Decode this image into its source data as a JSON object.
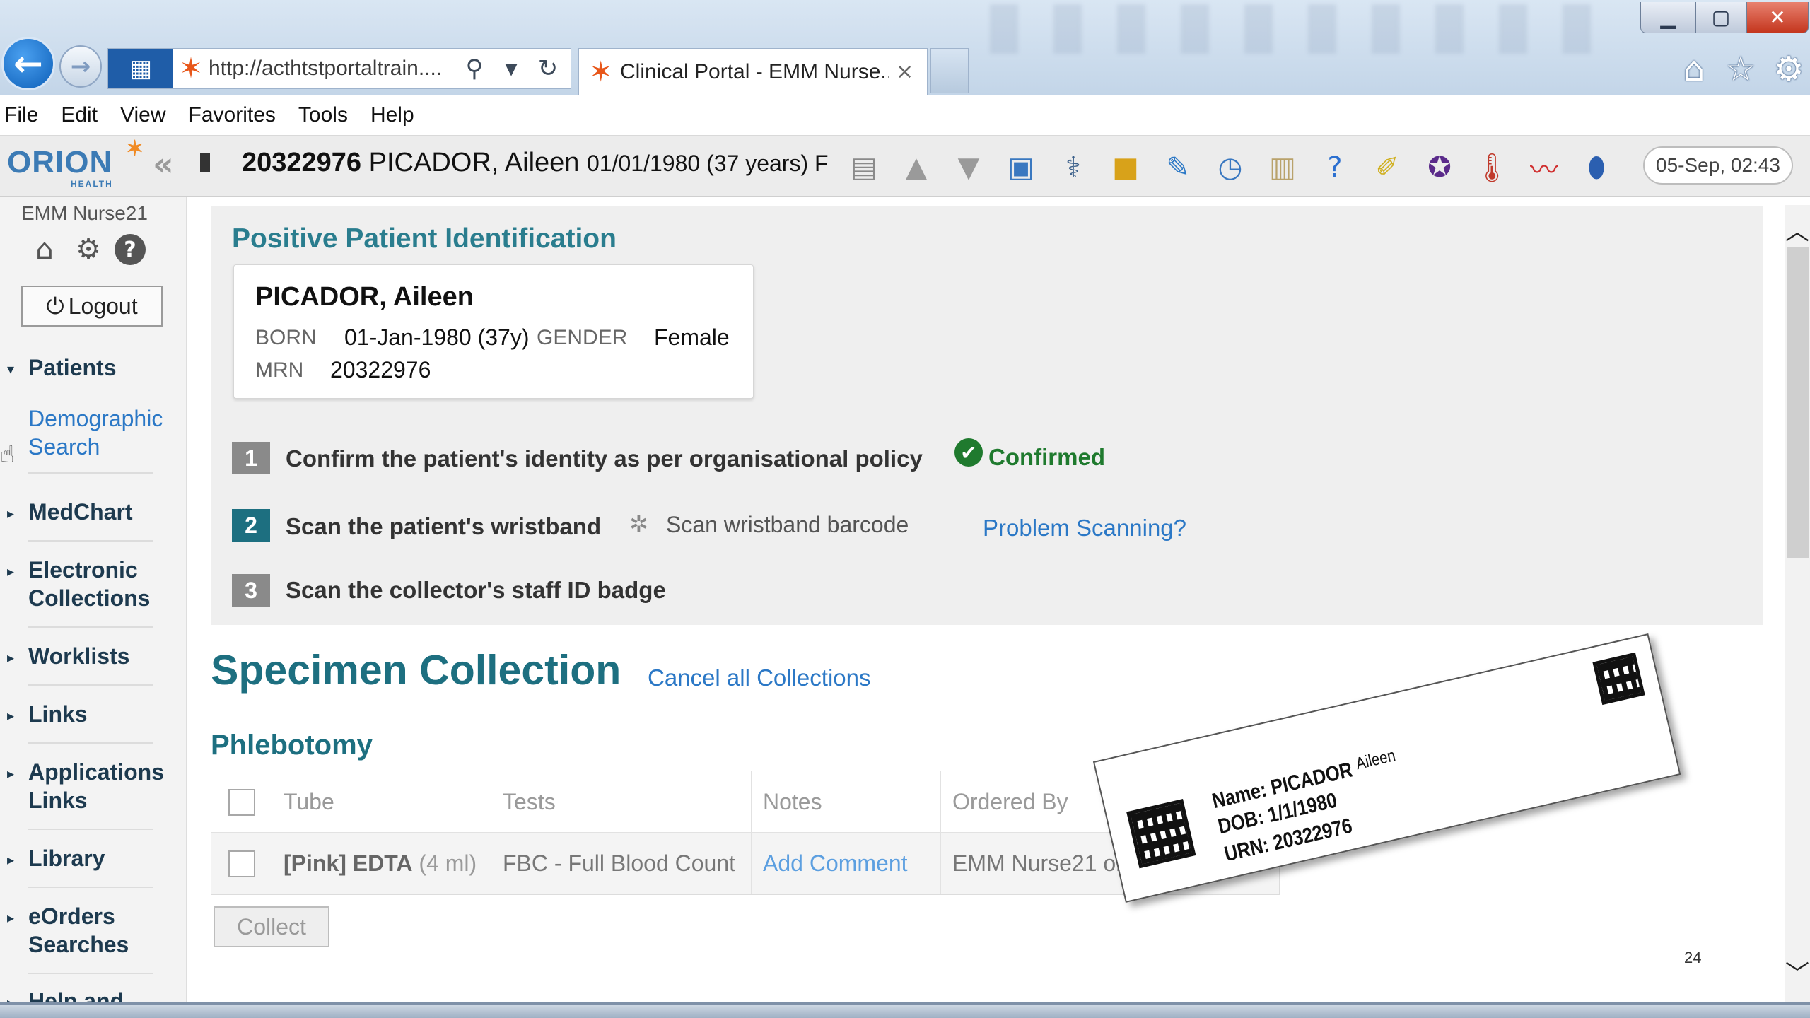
{
  "browser": {
    "address_url": "http://acthtstportaltrain....",
    "tab_title": "Clinical Portal - EMM Nurse...",
    "tab_close": "×",
    "menu": [
      "File",
      "Edit",
      "View",
      "Favorites",
      "Tools",
      "Help"
    ],
    "icons": {
      "back": "←",
      "forward": "→",
      "site": "▦",
      "star": "✶",
      "search": "⚲",
      "dropdown": "▾",
      "refresh": "↻",
      "home": "⌂",
      "favorites": "☆",
      "settings": "⚙",
      "minimize": "▁",
      "maximize": "▢",
      "close": "✕"
    }
  },
  "header": {
    "logo": "ORION",
    "logo_sub": "HEALTH",
    "collapse_icon": "«",
    "patient_mrn": "20322976",
    "patient_name": "PICADOR, Aileen",
    "patient_dob": "01/01/1980 (37 years) F",
    "datetime": "05-Sep, 02:43",
    "toolbar_icons": [
      {
        "name": "id-card-icon",
        "glyph": "▤",
        "color": "#8a8a8a"
      },
      {
        "name": "up-arrow-icon",
        "glyph": "▲",
        "color": "#9a9a9a"
      },
      {
        "name": "down-arrow-icon",
        "glyph": "▼",
        "color": "#9a9a9a"
      },
      {
        "name": "patient-details-icon",
        "glyph": "▣",
        "color": "#3a78c0"
      },
      {
        "name": "stethoscope-icon",
        "glyph": "⚕",
        "color": "#3a5f8a"
      },
      {
        "name": "folder-icon",
        "glyph": "■",
        "color": "#d8a21a"
      },
      {
        "name": "pen-icon",
        "glyph": "✎",
        "color": "#2b78c6"
      },
      {
        "name": "calendar-clock-icon",
        "glyph": "◷",
        "color": "#3a78c0"
      },
      {
        "name": "notes-icon",
        "glyph": "▥",
        "color": "#b9a26b"
      },
      {
        "name": "help-icon",
        "glyph": "?",
        "color": "#2b6fd0"
      },
      {
        "name": "edit-note-icon",
        "glyph": "✐",
        "color": "#d0b020"
      },
      {
        "name": "v-badge-icon",
        "glyph": "✪",
        "color": "#5a2a8a"
      },
      {
        "name": "thermometer-icon",
        "glyph": "🌡",
        "color": "#c0392b"
      },
      {
        "name": "chart-icon",
        "glyph": "〰",
        "color": "#d03030"
      },
      {
        "name": "medication-icon",
        "glyph": "⬮",
        "color": "#2b5fb0"
      }
    ]
  },
  "sidebar": {
    "user": "EMM Nurse21",
    "icons": {
      "home": "⌂",
      "settings": "⚙",
      "help": "?"
    },
    "logout": "Logout",
    "logout_icon": "⏻",
    "items": [
      {
        "label": "Patients",
        "open": true
      },
      {
        "label": "MedChart"
      },
      {
        "label": "Electronic Collections"
      },
      {
        "label": "Worklists"
      },
      {
        "label": "Links"
      },
      {
        "label": "Applications Links"
      },
      {
        "label": "Library"
      },
      {
        "label": "eOrders Searches"
      },
      {
        "label": "Help and"
      }
    ],
    "sub_item": "Demographic Search",
    "caret_closed": "▸",
    "caret_open": "▾"
  },
  "ppi": {
    "title": "Positive Patient Identification",
    "card": {
      "name": "PICADOR, Aileen",
      "born_label": "BORN",
      "born_value": "01-Jan-1980 (37y)",
      "gender_label": "GENDER",
      "gender_value": "Female",
      "mrn_label": "MRN",
      "mrn_value": "20322976"
    },
    "steps": [
      {
        "num": "1",
        "text": "Confirm the patient's identity as per organisational policy",
        "color": "#8a8a8a"
      },
      {
        "num": "2",
        "text": "Scan the patient's wristband",
        "color": "#1d6f80"
      },
      {
        "num": "3",
        "text": "Scan the collector's staff ID badge",
        "color": "#8a8a8a"
      }
    ],
    "confirmed": "Confirmed",
    "confirmed_icon": "✔",
    "spinner_icon": "✲",
    "scan_prompt": "Scan wristband barcode",
    "problem_link": "Problem Scanning?"
  },
  "specimen": {
    "title": "Specimen Collection",
    "cancel_link": "Cancel all Collections",
    "section": "Phlebotomy",
    "columns": [
      "Tube",
      "Tests",
      "Notes",
      "Ordered By"
    ],
    "rows": [
      {
        "tube_color": "[Pink] EDTA",
        "tube_volume": "(4 ml)",
        "tests": "FBC - Full Blood Count",
        "notes": "Add Comment",
        "ordered_by": "EMM Nurse21 on"
      }
    ],
    "collect_button": "Collect"
  },
  "wristband": {
    "name_label": "Name:",
    "name_last": "PICADOR",
    "name_first": "Aileen",
    "dob_label": "DOB:",
    "dob_value": "1/1/1980",
    "urn_label": "URN:",
    "urn_value": "20322976"
  },
  "slide_number": "24",
  "scroll": {
    "up": "︿",
    "down": "﹀"
  }
}
